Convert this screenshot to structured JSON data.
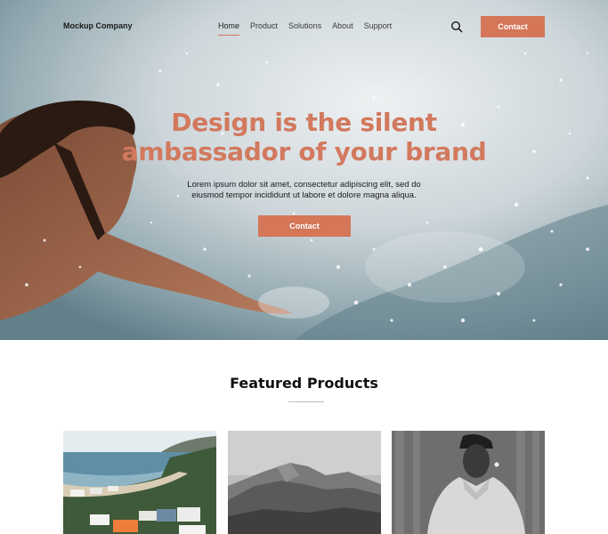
{
  "nav": {
    "brand": "Mockup Company",
    "items": [
      {
        "label": "Home",
        "active": true
      },
      {
        "label": "Product",
        "active": false
      },
      {
        "label": "Solutions",
        "active": false
      },
      {
        "label": "About",
        "active": false
      },
      {
        "label": "Support",
        "active": false
      }
    ],
    "search_icon": "search-icon",
    "contact_label": "Contact"
  },
  "hero": {
    "title_line1": "Design is the silent",
    "title_line2": "ambassador of your brand",
    "subtitle_line1": "Lorem ipsum dolor sit amet, consectetur adipiscing elit, sed do",
    "subtitle_line2": "eiusmod tempor incididunt ut labore et dolore magna aliqua.",
    "cta_label": "Contact"
  },
  "featured": {
    "title": "Featured Products",
    "products": [
      {
        "image": "coastline with campervans"
      },
      {
        "image": "black and white mountain"
      },
      {
        "image": "black and white portrait"
      }
    ]
  },
  "colors": {
    "accent": "#d57659",
    "heading_accent": "#d2795e",
    "text": "#1a1a1a"
  }
}
